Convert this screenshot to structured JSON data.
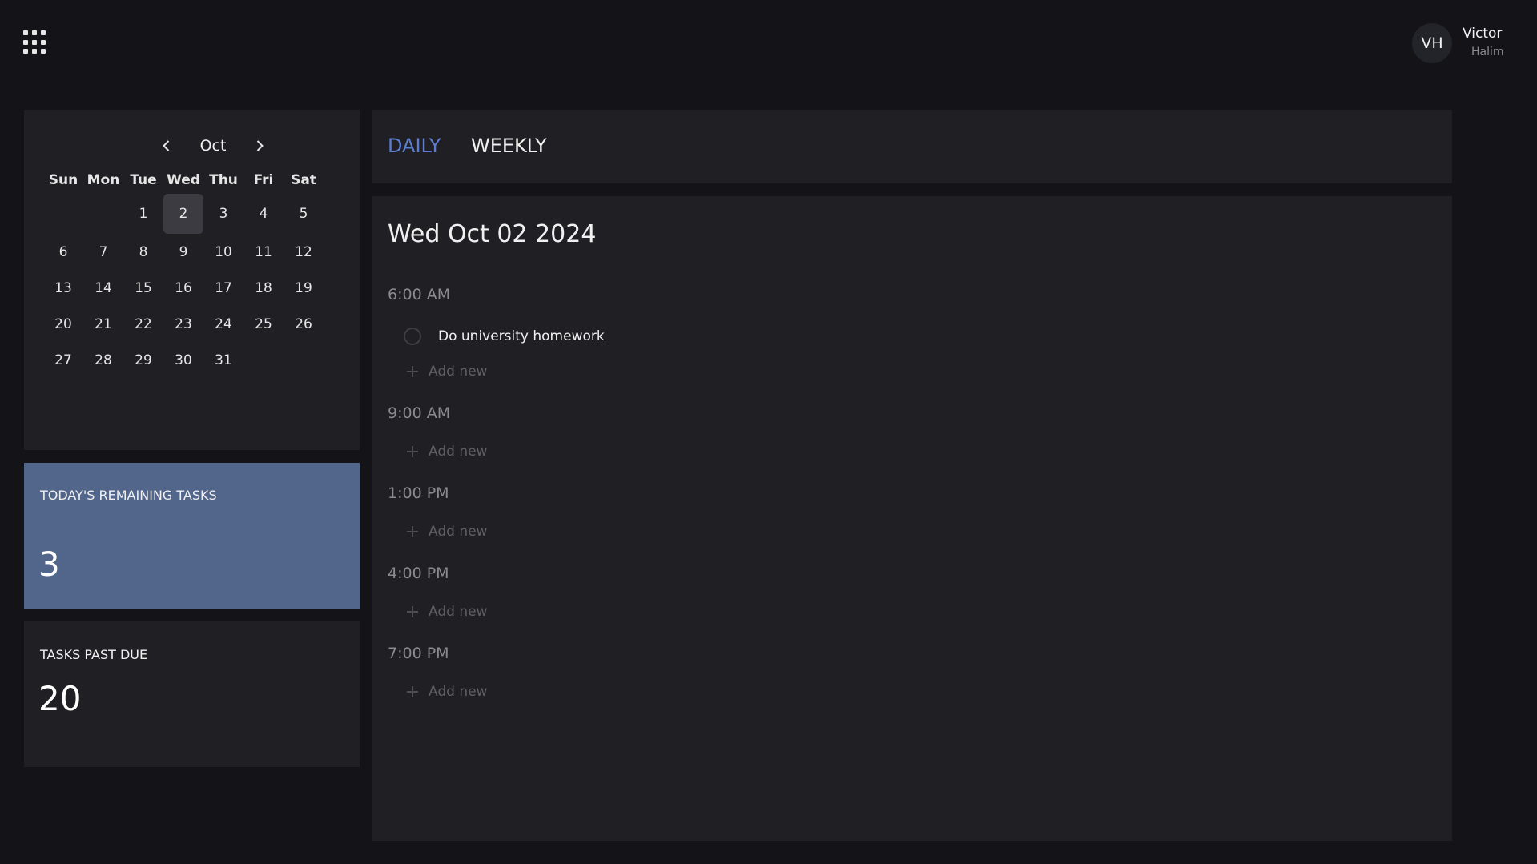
{
  "header": {
    "apps_icon": "grid-icon",
    "avatar_initials": "VH",
    "user_first": "Victor",
    "user_last": "Halim"
  },
  "calendar": {
    "month": "Oct",
    "prev_icon": "chevron-left-icon",
    "next_icon": "chevron-right-icon",
    "weekdays": [
      "Sun",
      "Mon",
      "Tue",
      "Wed",
      "Thu",
      "Fri",
      "Sat"
    ],
    "weeks": [
      [
        "",
        "",
        "1",
        "2",
        "3",
        "4",
        "5"
      ],
      [
        "6",
        "7",
        "8",
        "9",
        "10",
        "11",
        "12"
      ],
      [
        "13",
        "14",
        "15",
        "16",
        "17",
        "18",
        "19"
      ],
      [
        "20",
        "21",
        "22",
        "23",
        "24",
        "25",
        "26"
      ],
      [
        "27",
        "28",
        "29",
        "30",
        "31",
        "",
        ""
      ]
    ],
    "selected_day": "2"
  },
  "stats": {
    "remaining_label": "TODAY'S REMAINING TASKS",
    "remaining_value": "3",
    "pastdue_label": "TASKS PAST DUE",
    "pastdue_value": "20"
  },
  "tabs": {
    "daily": "DAILY",
    "weekly": "WEEKLY",
    "active": "daily"
  },
  "day": {
    "title": "Wed Oct 02 2024",
    "add_label": "Add new",
    "slots": [
      {
        "time": "6:00 AM",
        "tasks": [
          "Do university homework"
        ]
      },
      {
        "time": "9:00 AM",
        "tasks": []
      },
      {
        "time": "1:00 PM",
        "tasks": []
      },
      {
        "time": "4:00 PM",
        "tasks": []
      },
      {
        "time": "7:00 PM",
        "tasks": []
      }
    ]
  },
  "colors": {
    "background": "#131318",
    "panel": "#202024",
    "accent_blue": "#5d7dd1",
    "remaining_card": "#52668c"
  }
}
